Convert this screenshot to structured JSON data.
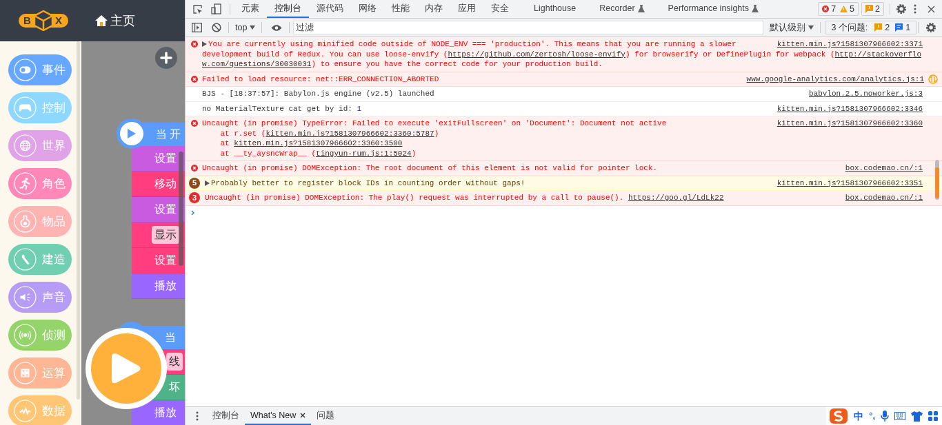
{
  "app": {
    "logo": {
      "left": "B",
      "right": "X"
    },
    "nav": "主页",
    "categories": [
      {
        "label": "事件",
        "color": "#66a8ff"
      },
      {
        "label": "控制",
        "color": "#8ed8ff"
      },
      {
        "label": "世界",
        "color": "#e0a3e8"
      },
      {
        "label": "角色",
        "color": "#ff88b8"
      },
      {
        "label": "物品",
        "color": "#ffb3b3"
      },
      {
        "label": "建造",
        "color": "#6fcfb0"
      },
      {
        "label": "声音",
        "color": "#b69cf5"
      },
      {
        "label": "侦测",
        "color": "#95d46a"
      },
      {
        "label": "运算",
        "color": "#ffb694"
      },
      {
        "label": "数据",
        "color": "#ffc675"
      }
    ],
    "block_groups": [
      {
        "hat": {
          "text": "当 开",
          "color": "#5b9cf9"
        },
        "blocks": [
          {
            "text": "设置",
            "color": "#c95be0"
          },
          {
            "text": "移动",
            "color": "#ff3d7f"
          },
          {
            "text": "设置",
            "color": "#c95be0"
          },
          {
            "text": "显示",
            "color": "#ff3d7f",
            "kind": "input"
          },
          {
            "text": "设置",
            "color": "#ff3d7f"
          },
          {
            "text": "播放",
            "color": "#9966ff"
          }
        ]
      },
      {
        "hat": {
          "text": "当",
          "color": "#5b9cf9"
        },
        "blocks": [
          {
            "text": "线",
            "color": "#ff3d7f",
            "kind": "input"
          },
          {
            "text": "坏",
            "color": "#4fb389"
          },
          {
            "text": "播放",
            "color": "#9966ff"
          }
        ]
      }
    ]
  },
  "devtools": {
    "tabs": [
      {
        "label": "元素",
        "selected": false
      },
      {
        "label": "控制台",
        "selected": true
      },
      {
        "label": "源代码",
        "selected": false
      },
      {
        "label": "网络",
        "selected": false
      },
      {
        "label": "性能",
        "selected": false
      },
      {
        "label": "内存",
        "selected": false
      },
      {
        "label": "应用",
        "selected": false
      },
      {
        "label": "安全",
        "selected": false
      },
      {
        "label": "Lighthouse",
        "selected": false
      },
      {
        "label": "Recorder",
        "selected": false,
        "experimental": true
      },
      {
        "label": "Performance insights",
        "selected": false,
        "experimental": true
      }
    ],
    "counters": {
      "errors": "7",
      "warnings": "5",
      "issues": "2"
    },
    "toolbar": {
      "context": "top",
      "filter_placeholder": "过滤",
      "level": "默认级别",
      "issues_label": "3 个问题:",
      "issues_warning": "2",
      "issues_info": "1"
    },
    "messages": [
      {
        "kind": "error",
        "expandable": true,
        "lines": [
          [
            {
              "t": "You are currently using minified code outside of NODE_ENV === 'production'. This means that you are running a slower"
            }
          ],
          [
            {
              "t": "development build of Redux. You can use loose-envify ("
            },
            {
              "t": "https://github.com/zertosh/loose-envify",
              "link": true
            },
            {
              "t": ") for browserify or DefinePlugin for webpack ("
            },
            {
              "t": "http://stackoverflo",
              "link": true
            }
          ],
          [
            {
              "t": "w.com/questions/30030031",
              "link": true
            },
            {
              "t": ") to ensure you have the correct code for your production build."
            }
          ]
        ],
        "source": "kitten.min.js?1581307966602:3371"
      },
      {
        "kind": "error",
        "lines": [
          [
            {
              "t": "Failed to load resource: net::ERR_CONNECTION_ABORTED"
            }
          ]
        ],
        "source": "www.google-analytics.com/analytics.js:1",
        "network_icon": true
      },
      {
        "kind": "log",
        "lines": [
          [
            {
              "t": "BJS - [18:37:57]: Babylon.js engine (v2.5) launched"
            }
          ]
        ],
        "source": "babylon.2.5.noworker.js:3"
      },
      {
        "kind": "log",
        "lines": [
          [
            {
              "t": "no MaterialTexture cat get by id: "
            },
            {
              "t": "1",
              "number": true
            }
          ]
        ],
        "source": "kitten.min.js?1581307966602:3346"
      },
      {
        "kind": "error",
        "lines": [
          [
            {
              "t": "Uncaught (in promise) TypeError: Failed to execute 'exitFullscreen' on 'Document': Document not active"
            }
          ],
          [
            {
              "t": "    at r.set ("
            },
            {
              "t": "kitten.min.js?1581307966602:3360:5787",
              "link": true
            },
            {
              "t": ")"
            }
          ],
          [
            {
              "t": "    at "
            },
            {
              "t": "kitten.min.js?1581307966602:3360:3500",
              "link": true
            }
          ],
          [
            {
              "t": "    at __ty_aysncWrap__ ("
            },
            {
              "t": "tingyun-rum.js:1:5024",
              "link": true
            },
            {
              "t": ")"
            }
          ]
        ],
        "source": "kitten.min.js?1581307966602:3360"
      },
      {
        "kind": "error",
        "lines": [
          [
            {
              "t": "Uncaught (in promise) DOMException: The root document of this element is not valid for pointer lock."
            }
          ]
        ],
        "source": "box.codemao.cn/:1"
      },
      {
        "kind": "warning",
        "count": "5",
        "expandable": true,
        "lines": [
          [
            {
              "t": "Probably better to register block IDs in counting order without gaps!"
            }
          ]
        ],
        "source": "kitten.min.js?1581307966602:3351"
      },
      {
        "kind": "error",
        "count": "3",
        "lines": [
          [
            {
              "t": "Uncaught (in promise) DOMException: The play() request was interrupted by a call to pause(). "
            },
            {
              "t": "https://goo.gl/LdLk22",
              "link": true
            }
          ]
        ],
        "source": "box.codemao.cn/:1"
      }
    ],
    "drawer_tabs": [
      {
        "label": "控制台",
        "selected": false
      },
      {
        "label": "What's New",
        "selected": true,
        "closable": true
      },
      {
        "label": "问题",
        "selected": false
      }
    ]
  },
  "ime": {
    "mode": "中",
    "punctuation": "°,"
  }
}
